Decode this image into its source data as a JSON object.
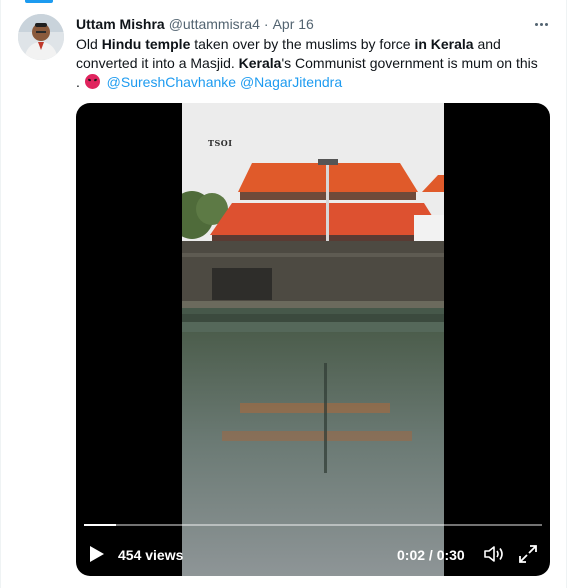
{
  "tweet": {
    "author_name": "Uttam Mishra",
    "author_handle": "@uttammisra4",
    "separator": "·",
    "date": "Apr 16",
    "text_line1": {
      "t1": "Old ",
      "b1": "Hindu temple",
      "t2": " taken over by the muslims by force ",
      "b2": "in Kerala",
      "t3": " and"
    },
    "text_line2": {
      "t1": "converted it into a Masjid. ",
      "b1": "Kerala",
      "t2": "'s Communist government is mum on this"
    },
    "text_line3": {
      "lead": ". ",
      "mention1": "@SureshChavhanke",
      "mention2": "@NagarJitendra"
    },
    "emoji_icon": "angry-face-icon"
  },
  "video": {
    "watermark": "TSOI",
    "views": "454 views",
    "time": "0:02 / 0:30",
    "progress": 0.07,
    "play_icon": "play-icon",
    "volume_icon": "volume-icon",
    "fullscreen_icon": "fullscreen-icon"
  },
  "colors": {
    "accent": "#1d9bf0",
    "text_primary": "#0f1419",
    "text_secondary": "#536471",
    "video_background": "#000000"
  }
}
